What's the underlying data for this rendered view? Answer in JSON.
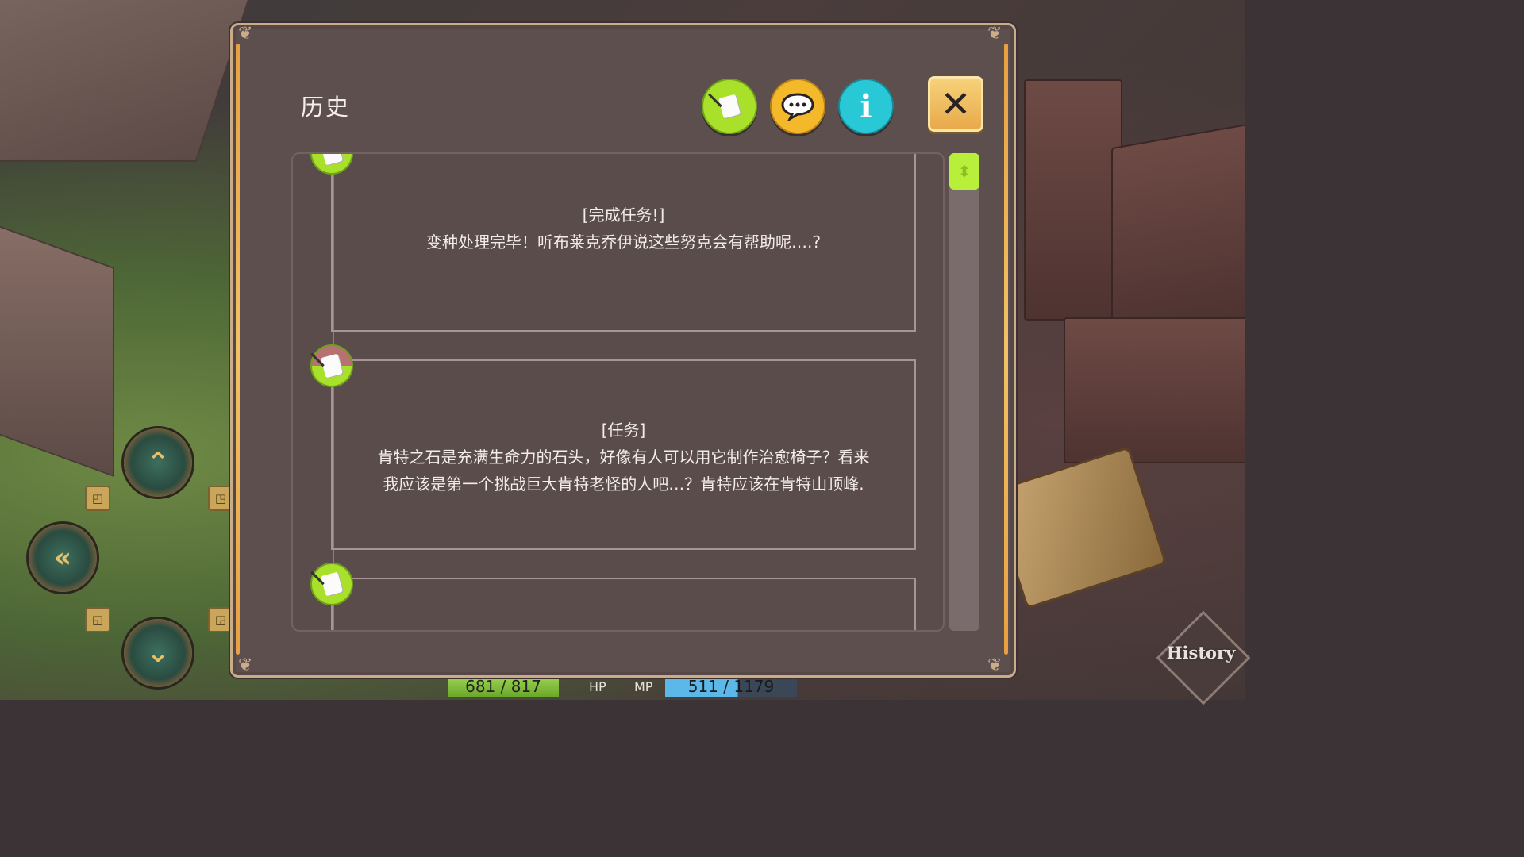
{
  "dialog": {
    "title": "历史",
    "tabs": [
      {
        "id": "quest",
        "icon": "quest-scroll-icon",
        "color": "#a8e02a"
      },
      {
        "id": "chat",
        "icon": "speech-bubble-icon",
        "color": "#f4b92a"
      },
      {
        "id": "info",
        "icon": "info-icon",
        "label": "i",
        "color": "#29c8d6"
      }
    ],
    "close_label": "✕"
  },
  "entries": [
    {
      "header": "[完成任务!]",
      "lines": [
        "变种处理完毕！听布莱克乔伊说这些努克会有帮助呢….?"
      ]
    },
    {
      "header": "[任务]",
      "lines": [
        "肯特之石是充满生命力的石头，好像有人可以用它制作治愈椅子？看来",
        "我应该是第一个挑战巨大肯特老怪的人吧…？肯特应该在肯特山顶峰."
      ]
    }
  ],
  "hud": {
    "hp_text": "681 / 817",
    "hp_label": "HP",
    "mp_label": "MP",
    "mp_text": "511 / 1179",
    "history_label": "History"
  }
}
